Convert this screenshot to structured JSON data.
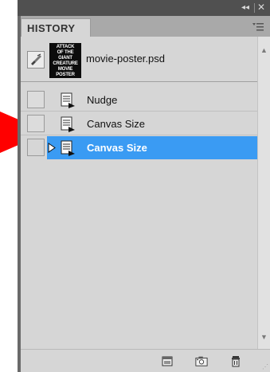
{
  "panel": {
    "collapse_glyph": "◂◂",
    "close_glyph": "✕",
    "tab_label": "HISTORY",
    "menu_icon": "panel-menu-icon"
  },
  "snapshot": {
    "thumbnail_text": [
      "ATTACK",
      "OF THE",
      "GIANT",
      "CREATURE",
      "MOVIE",
      "POSTER"
    ],
    "document_name": "movie-poster.psd"
  },
  "history": {
    "steps": [
      {
        "label": "Nudge",
        "selected": false
      },
      {
        "label": "Canvas Size",
        "selected": false
      },
      {
        "label": "Canvas Size",
        "selected": true
      }
    ]
  },
  "bottom_bar": {
    "buttons": [
      "create-new-document-icon",
      "create-snapshot-icon",
      "delete-icon"
    ]
  },
  "colors": {
    "selection": "#3a9bf3",
    "annotation_arrow": "#ff0000",
    "panel_bg": "#d6d6d6"
  }
}
